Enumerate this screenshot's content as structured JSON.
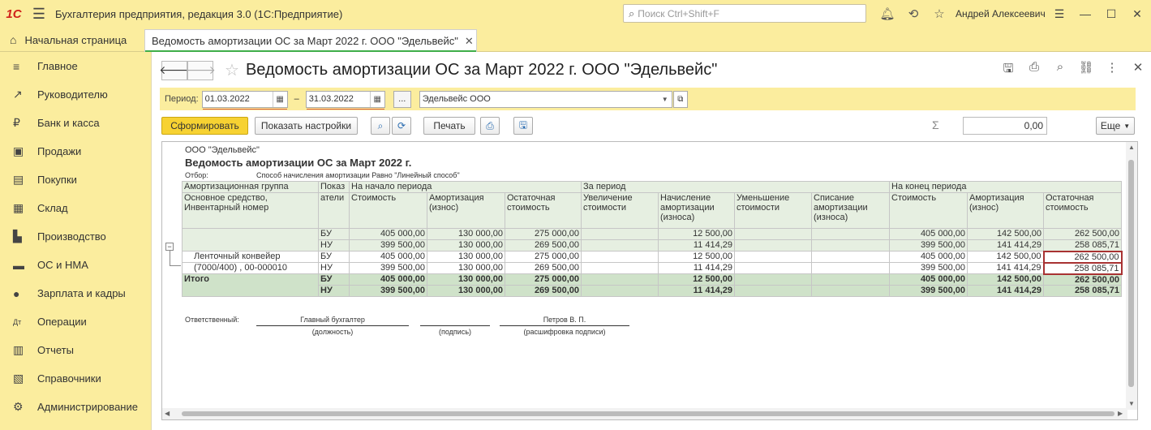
{
  "app": {
    "logo": "1С",
    "title": "Бухгалтерия предприятия, редакция 3.0  (1С:Предприятие)",
    "search_placeholder": "Поиск Ctrl+Shift+F",
    "user": "Андрей Алексеевич"
  },
  "tabs": {
    "home": "Начальная страница",
    "doc": "Ведомость амортизации ОС за Март 2022 г. ООО \"Эдельвейс\""
  },
  "sidebar": [
    {
      "label": "Главное",
      "icon": "≡"
    },
    {
      "label": "Руководителю",
      "icon": "↗"
    },
    {
      "label": "Банк и касса",
      "icon": "₽"
    },
    {
      "label": "Продажи",
      "icon": "▣"
    },
    {
      "label": "Покупки",
      "icon": "▤"
    },
    {
      "label": "Склад",
      "icon": "▦"
    },
    {
      "label": "Производство",
      "icon": "▙"
    },
    {
      "label": "ОС и НМА",
      "icon": "▬"
    },
    {
      "label": "Зарплата и кадры",
      "icon": "●"
    },
    {
      "label": "Операции",
      "icon": "Дт"
    },
    {
      "label": "Отчеты",
      "icon": "▥"
    },
    {
      "label": "Справочники",
      "icon": "▧"
    },
    {
      "label": "Администрирование",
      "icon": "⚙"
    }
  ],
  "header": {
    "title": "Ведомость амортизации ОС за Март 2022 г. ООО \"Эдельвейс\""
  },
  "params": {
    "period_label": "Период:",
    "date_from": "01.03.2022",
    "date_to": "31.03.2022",
    "dash": "–",
    "dots": "...",
    "org": "Эдельвейс ООО"
  },
  "commands": {
    "generate": "Сформировать",
    "settings": "Показать настройки",
    "print": "Печать",
    "sum": "0,00",
    "more": "Еще"
  },
  "report": {
    "org": "ООО \"Эдельвейс\"",
    "title": "Ведомость амортизации ОС за Март 2022 г.",
    "filter_label": "Отбор:",
    "filter_value": "Способ начисления амортизации Равно \"Линейный способ\"",
    "h": {
      "group": "Амортизационная группа",
      "asset": "Основное средство,",
      "inv": "Инвентарный номер",
      "ind1": "Показ",
      "ind2": "атели",
      "start": "На начало периода",
      "period": "За период",
      "end": "На конец периода",
      "cost": "Стоимость",
      "amort1": "Амортизация",
      "amort2": "(износ)",
      "resid1": "Остаточная",
      "resid2": "стоимость",
      "inc1": "Увеличение",
      "inc2": "стоимости",
      "acc1": "Начисление",
      "acc2": "амортизации",
      "acc3": "(износа)",
      "dec1": "Уменьшение",
      "dec2": "стоимости",
      "wo1": "Списание",
      "wo2": "амортизации",
      "wo3": "(износа)"
    },
    "rows": [
      {
        "k": "БУ",
        "a": "405 000,00",
        "b": "130 000,00",
        "c": "275 000,00",
        "d": "",
        "e": "12 500,00",
        "f": "",
        "g": "",
        "h": "405 000,00",
        "i": "142 500,00",
        "j": "262 500,00"
      },
      {
        "k": "НУ",
        "a": "399 500,00",
        "b": "130 000,00",
        "c": "269 500,00",
        "d": "",
        "e": "11 414,29",
        "f": "",
        "g": "",
        "h": "399 500,00",
        "i": "141 414,29",
        "j": "258 085,71"
      },
      {
        "name": "Ленточный конвейер",
        "k": "БУ",
        "a": "405 000,00",
        "b": "130 000,00",
        "c": "275 000,00",
        "d": "",
        "e": "12 500,00",
        "f": "",
        "g": "",
        "h": "405 000,00",
        "i": "142 500,00",
        "j": "262 500,00"
      },
      {
        "name": "(7000/400) , 00-000010",
        "k": "НУ",
        "a": "399 500,00",
        "b": "130 000,00",
        "c": "269 500,00",
        "d": "",
        "e": "11 414,29",
        "f": "",
        "g": "",
        "h": "399 500,00",
        "i": "141 414,29",
        "j": "258 085,71"
      },
      {
        "name": "Итого",
        "k": "БУ",
        "a": "405 000,00",
        "b": "130 000,00",
        "c": "275 000,00",
        "d": "",
        "e": "12 500,00",
        "f": "",
        "g": "",
        "h": "405 000,00",
        "i": "142 500,00",
        "j": "262 500,00"
      },
      {
        "k": "НУ",
        "a": "399 500,00",
        "b": "130 000,00",
        "c": "269 500,00",
        "d": "",
        "e": "11 414,29",
        "f": "",
        "g": "",
        "h": "399 500,00",
        "i": "141 414,29",
        "j": "258 085,71"
      }
    ],
    "sign": {
      "resp": "Ответственный:",
      "pos": "Главный бухгалтер",
      "pos_cap": "(должность)",
      "sig_cap": "(подпись)",
      "name": "Петров В. П.",
      "name_cap": "(расшифровка подписи)"
    }
  }
}
